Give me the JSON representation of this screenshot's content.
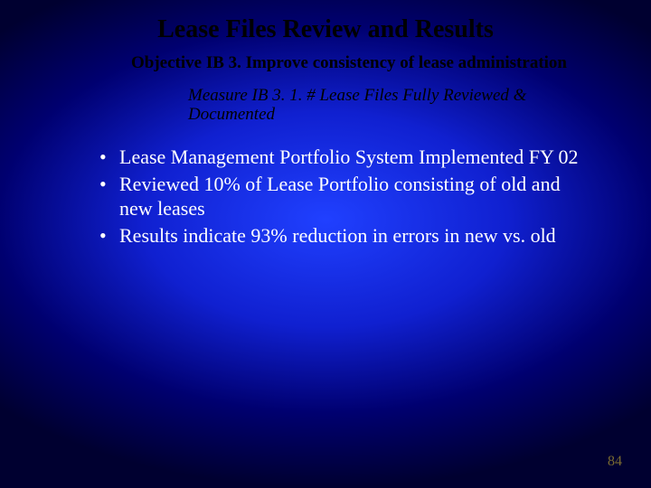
{
  "title": "Lease Files Review and Results",
  "objective": "Objective IB 3. Improve consistency of lease administration",
  "measure": "Measure IB 3. 1. # Lease Files Fully Reviewed & Documented",
  "bullets": [
    "Lease Management Portfolio System Implemented FY 02",
    "Reviewed 10% of Lease Portfolio consisting of old and new leases",
    "Results indicate 93% reduction in errors in new vs. old"
  ],
  "page_number": "84"
}
